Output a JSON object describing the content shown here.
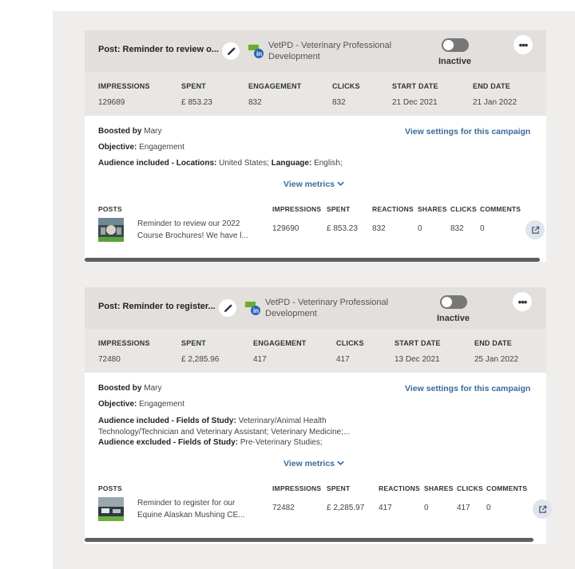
{
  "campaigns": [
    {
      "title": "Post: Reminder to review o...",
      "org_line1": "VetPD - Veterinary Professional",
      "org_line2": "Development",
      "status": "Inactive",
      "stats": [
        {
          "label": "IMPRESSIONS",
          "value": "129689"
        },
        {
          "label": "SPENT",
          "value": "£ 853.23"
        },
        {
          "label": "ENGAGEMENT",
          "value": "832"
        },
        {
          "label": "CLICKS",
          "value": "832"
        },
        {
          "label": "START DATE",
          "value": "21 Dec 2021"
        },
        {
          "label": "END DATE",
          "value": "21 Jan 2022"
        }
      ],
      "boosted_label": "Boosted by",
      "boosted_by": "Mary",
      "objective_label": "Objective:",
      "objective": "Engagement",
      "view_settings": "View settings for this campaign",
      "audience_inc_label": "Audience included - Locations:",
      "audience_inc_value": "United States;",
      "audience_lang_label": "Language:",
      "audience_lang_value": "English;",
      "view_metrics": "View metrics",
      "posts_headers": [
        "POSTS",
        "IMPRESSIONS",
        "SPENT",
        "REACTIONS",
        "SHARES",
        "CLICKS",
        "COMMENTS"
      ],
      "post": {
        "text_line1": "Reminder to review our 2022",
        "text_line2": "Course Brochures! We have l...",
        "impressions": "129690",
        "spent": "£ 853.23",
        "reactions": "832",
        "shares": "0",
        "clicks": "832",
        "comments": "0"
      }
    },
    {
      "title": "Post: Reminder to register...",
      "org_line1": "VetPD - Veterinary Professional",
      "org_line2": "Development",
      "status": "Inactive",
      "stats": [
        {
          "label": "IMPRESSIONS",
          "value": "72480"
        },
        {
          "label": "SPENT",
          "value": "£ 2,285.96"
        },
        {
          "label": "ENGAGEMENT",
          "value": "417"
        },
        {
          "label": "CLICKS",
          "value": "417"
        },
        {
          "label": "START DATE",
          "value": "13 Dec 2021"
        },
        {
          "label": "END DATE",
          "value": "25 Jan 2022"
        }
      ],
      "boosted_label": "Boosted by",
      "boosted_by": "Mary",
      "objective_label": "Objective:",
      "objective": "Engagement",
      "view_settings": "View settings for this campaign",
      "audience_inc_label": "Audience included - Fields of Study:",
      "audience_inc_value": "Veterinary/Animal Health",
      "audience_inc_value2": "Technology/Technician and Veterinary Assistant; Veterinary Medicine;...",
      "audience_exc_label": "Audience excluded - Fields of Study:",
      "audience_exc_value": "Pre-Veterinary Studies;",
      "view_metrics": "View metrics",
      "posts_headers": [
        "POSTS",
        "IMPRESSIONS",
        "SPENT",
        "REACTIONS",
        "SHARES",
        "CLICKS",
        "COMMENTS"
      ],
      "post": {
        "text_line1": "Reminder to register for our",
        "text_line2": "Equine Alaskan Mushing CE...",
        "impressions": "72482",
        "spent": "£ 2,285.97",
        "reactions": "417",
        "shares": "0",
        "clicks": "417",
        "comments": "0"
      }
    }
  ],
  "icons": {
    "edit": "pencil-icon",
    "more": "more-options-icon",
    "chevron": "chevron-down-icon",
    "external": "external-link-icon",
    "linkedin": "linkedin-icon"
  },
  "colors": {
    "link": "#3a6a9a",
    "header_bg": "#e2dfdc",
    "stats_bg": "#e9e7e4",
    "toggle_off": "#777777"
  }
}
